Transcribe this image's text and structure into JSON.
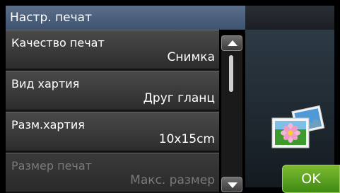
{
  "header": {
    "title": "Настр. печат"
  },
  "settings": [
    {
      "label": "Качество печат",
      "value": "Снимка",
      "enabled": true
    },
    {
      "label": "Вид хартия",
      "value": "Друг гланц",
      "enabled": true
    },
    {
      "label": "Разм.хартия",
      "value": "10x15cm",
      "enabled": true
    },
    {
      "label": "Размер печат",
      "value": "Макс. размер",
      "enabled": false
    }
  ],
  "buttons": {
    "ok_label": "OK"
  },
  "icons": {
    "scroll_up": "chevron-up-icon",
    "scroll_down": "chevron-down-icon",
    "photo": "photo-icon"
  },
  "colors": {
    "title_bar": "#4a5f7d",
    "ok_button": "#5aa21f",
    "disabled_text": "#7a7a7a"
  }
}
